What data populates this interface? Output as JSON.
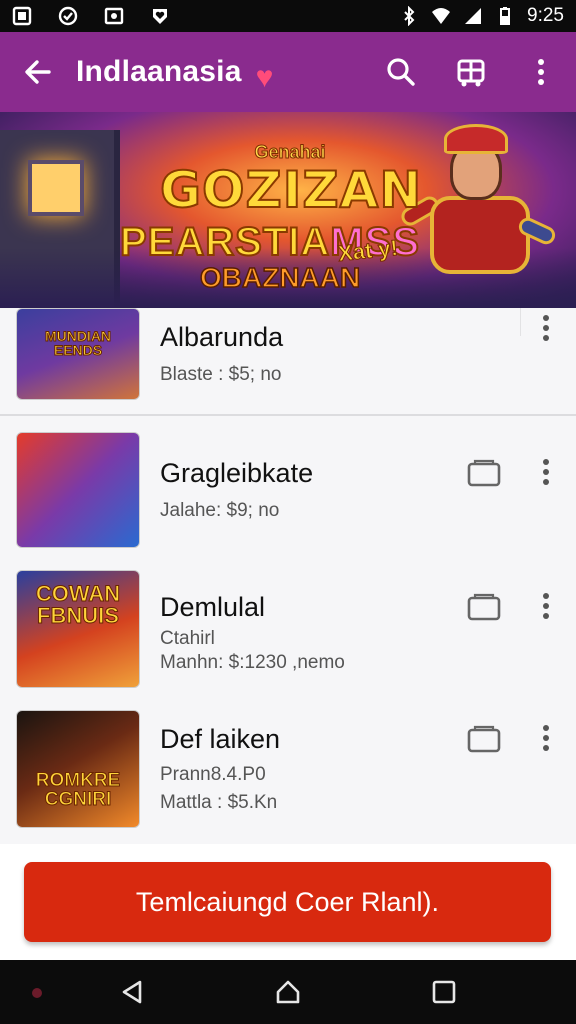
{
  "status_bar": {
    "time": "9:25",
    "icons": [
      "gallery-icon",
      "shield-icon",
      "image-icon",
      "heart-badge-icon",
      "bluetooth-icon",
      "wifi-icon",
      "signal-icon",
      "battery-icon"
    ]
  },
  "app_bar": {
    "title": "Indlaanasia",
    "icons": [
      "back-arrow-icon",
      "heart-icon",
      "search-icon",
      "cart-icon",
      "more-vert-icon"
    ],
    "accent": "#8a2b8e"
  },
  "banner": {
    "small_text": "Genahai",
    "title": "GOZIZAN",
    "line2_a": "PEARSTIA",
    "line2_b": "MSS",
    "line3": "OBAZNAAN",
    "side_text": "Xat y!"
  },
  "games": [
    {
      "name": "Albarunda",
      "meta_lines": [
        "Blaste : $5; no"
      ],
      "thumb_text": "MUNDIAN EENDS",
      "has_folder": false
    },
    {
      "name": "Gragleibkate",
      "meta_lines": [
        "Jalahe: $9; no"
      ],
      "thumb_text": "",
      "has_folder": true
    },
    {
      "name": "Demlulal",
      "meta_lines": [
        "Ctahirl",
        "Manhn: $:1230 ,nemo"
      ],
      "thumb_text": "COWAN FBNUIS",
      "has_folder": true
    },
    {
      "name": "Def laiken",
      "meta_lines": [
        "Prann8.4.P0",
        "Mattla : $5.Kn"
      ],
      "thumb_text": "ROMKRE CGNIRI",
      "has_folder": true
    }
  ],
  "primary_button": {
    "label": "Temlcaiungd Coer Rlanl).",
    "color": "#d8290f"
  },
  "nav_bar": {
    "icons": [
      "back-triangle-icon",
      "home-icon",
      "recents-square-icon"
    ]
  }
}
